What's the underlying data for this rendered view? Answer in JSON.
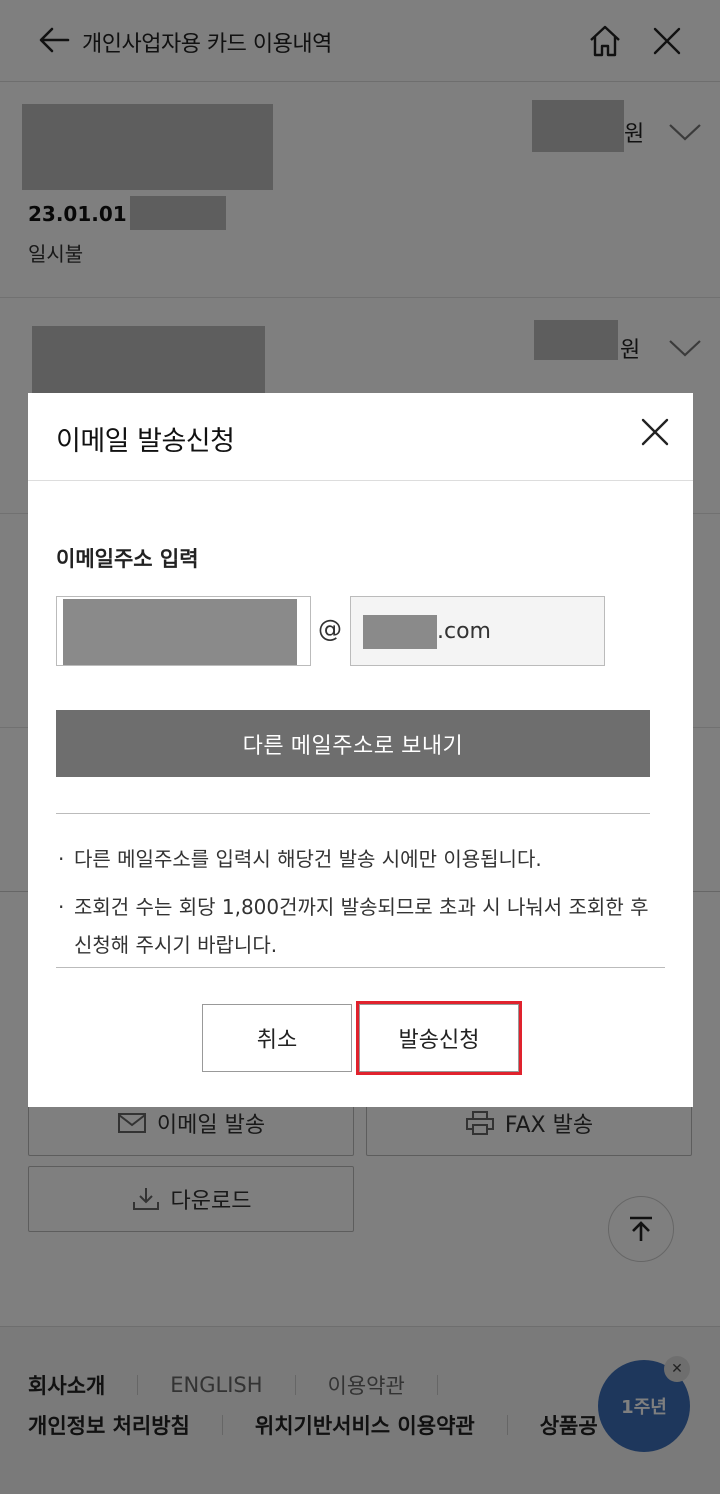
{
  "header": {
    "title": "개인사업자용 카드 이용내역"
  },
  "transactions": [
    {
      "date": "23.01.01",
      "type": "일시불",
      "amount_unit": "원"
    },
    {
      "amount_unit": "원"
    }
  ],
  "actions": {
    "email_send": "이메일 발송",
    "fax_send": "FAX 발송",
    "download": "다운로드"
  },
  "footer": {
    "row1": [
      "회사소개",
      "ENGLISH",
      "이용약관"
    ],
    "row2": [
      "개인정보 처리방침",
      "위치기반서비스 이용약관",
      "상품공"
    ],
    "mascot_text": "1주년"
  },
  "modal": {
    "title": "이메일 발송신청",
    "email_label": "이메일주소 입력",
    "at_sign": "@",
    "domain_suffix": ".com",
    "send_other_label": "다른 메일주소로 보내기",
    "notices": [
      "다른 메일주소를 입력시 해당건 발송 시에만 이용됩니다.",
      "조회건 수는 회당 1,800건까지 발송되므로 초과 시 나눠서 조회한 후 신청해 주시기 바랍니다."
    ],
    "cancel_label": "취소",
    "submit_label": "발송신청"
  },
  "colors": {
    "highlight": "#e0222d",
    "primary_gray": "#6e6e6e"
  }
}
